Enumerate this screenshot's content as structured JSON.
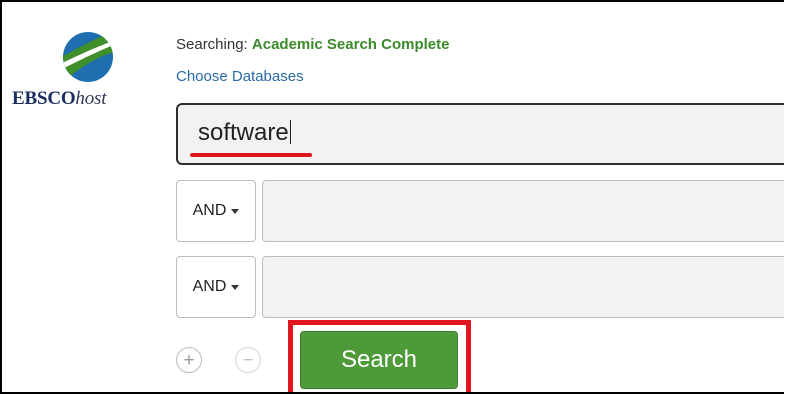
{
  "logo": {
    "brand": "EBSCO",
    "suffix": "host"
  },
  "search": {
    "searching_label": "Searching:",
    "database_name": "Academic Search Complete",
    "choose_databases_link": "Choose Databases",
    "main_query_value": "software"
  },
  "rows": [
    {
      "operator": "AND",
      "value": ""
    },
    {
      "operator": "AND",
      "value": ""
    }
  ],
  "controls": {
    "add_row_symbol": "+",
    "remove_row_symbol": "−",
    "search_button_label": "Search"
  },
  "colors": {
    "accent_green": "#4e9a38",
    "db_name_green": "#3a8a2a",
    "link_blue": "#2a6aa8",
    "annotation_red": "#e0161c",
    "logo_navy": "#1a2d5c"
  },
  "icons": {
    "logo_mark": "ebsco-logo-icon",
    "dropdown": "caret-down-icon",
    "add": "plus-circle-icon",
    "remove": "minus-circle-icon"
  }
}
